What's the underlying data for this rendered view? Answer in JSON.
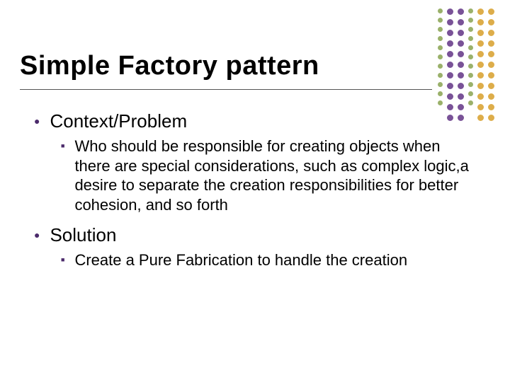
{
  "title": "Simple Factory pattern",
  "sections": [
    {
      "heading": "Context/Problem",
      "item": "Who should be responsible for creating objects when there are special considerations, such as complex logic,a desire to separate the creation responsibilities for better cohesion, and so forth"
    },
    {
      "heading": "Solution",
      "item": "Create a Pure Fabrication to handle the creation"
    }
  ]
}
